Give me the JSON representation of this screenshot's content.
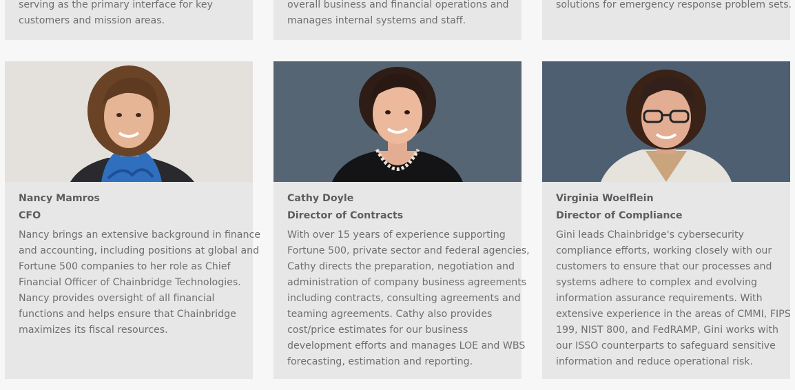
{
  "top_cards": [
    {
      "lines": [
        "serving as the primary interface for key",
        "customers and mission areas."
      ]
    },
    {
      "lines": [
        "overall business and financial operations and",
        "manages internal systems and staff."
      ]
    },
    {
      "lines": [
        "solutions for emergency response problem sets."
      ]
    }
  ],
  "team": [
    {
      "name": "Nancy Mamros",
      "title": "CFO",
      "photo": "headshot-woman-blue-scarf",
      "bio": [
        "Nancy brings an extensive background in finance",
        "and accounting, including positions at global and",
        "Fortune 500 companies to her role as Chief",
        "Financial Officer of Chainbridge Technologies.",
        "Nancy provides oversight of all financial",
        "functions and helps ensure that Chainbridge",
        "maximizes its fiscal resources."
      ]
    },
    {
      "name": "Cathy Doyle",
      "title": "Director of Contracts",
      "photo": "headshot-woman-necklace",
      "bio": [
        "With over 15 years of experience supporting",
        "Fortune 500, private sector and federal agencies,",
        "Cathy directs the preparation, negotiation and",
        "administration of company business agreements",
        "including contracts, consulting agreements and",
        "teaming agreements. Cathy also provides",
        "cost/price estimates for our business",
        "development efforts and manages LOE and WBS",
        "forecasting, estimation and reporting."
      ]
    },
    {
      "name": "Virginia Woelflein",
      "title": "Director of Compliance",
      "photo": "headshot-woman-glasses",
      "bio": [
        "Gini leads Chainbridge's cybersecurity",
        "compliance efforts, working closely with our",
        "customers to ensure that our processes and",
        "systems adhere to complex and evolving",
        "information assurance requirements. With",
        "extensive experience in the areas of CMMI, FIPS",
        "199, NIST 800, and FedRAMP, Gini works with",
        "our ISSO counterparts to safeguard sensitive",
        "information and reduce operational risk."
      ]
    }
  ]
}
